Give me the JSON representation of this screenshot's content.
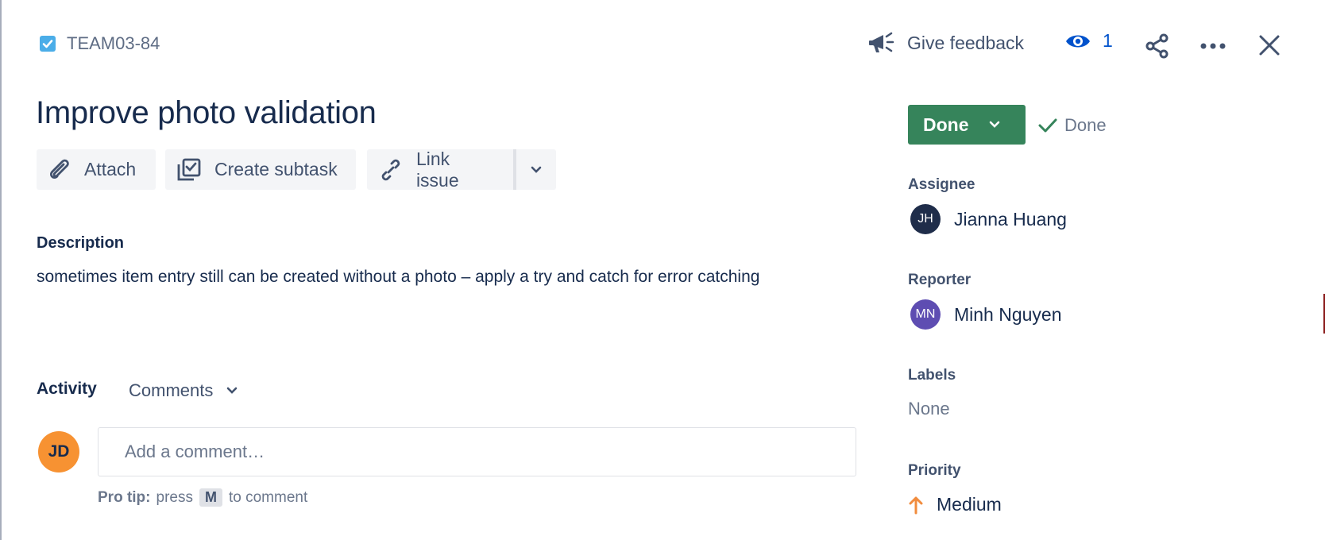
{
  "issue": {
    "key": "TEAM03-84",
    "type_icon": "task-checkbox-icon",
    "title": "Improve photo validation"
  },
  "header": {
    "feedback_label": "Give feedback",
    "watchers_count": "1"
  },
  "actions": {
    "attach": "Attach",
    "create_subtask": "Create subtask",
    "link_issue": "Link issue"
  },
  "description": {
    "label": "Description",
    "text": "sometimes item entry still can be created without a photo – apply a try and catch for error catching"
  },
  "activity": {
    "label": "Activity",
    "filter": "Comments",
    "current_user_initials": "JD",
    "comment_placeholder": "Add a comment…",
    "protip_prefix": "Pro tip:",
    "protip_press": "press",
    "protip_key": "M",
    "protip_suffix": "to comment"
  },
  "sidebar": {
    "status": "Done",
    "resolution": "Done",
    "assignee_label": "Assignee",
    "assignee_name": "Jianna Huang",
    "assignee_initials": "JH",
    "reporter_label": "Reporter",
    "reporter_name": "Minh Nguyen",
    "reporter_initials": "MN",
    "labels_label": "Labels",
    "labels_value": "None",
    "priority_label": "Priority",
    "priority_value": "Medium"
  },
  "colors": {
    "status_green": "#36845b",
    "task_blue": "#4bade8",
    "watch_blue": "#0052cc",
    "priority_orange": "#f18c3e",
    "avatar_jd": "#f79232",
    "avatar_jh": "#1f2d4a",
    "avatar_mn": "#5e4db2"
  }
}
